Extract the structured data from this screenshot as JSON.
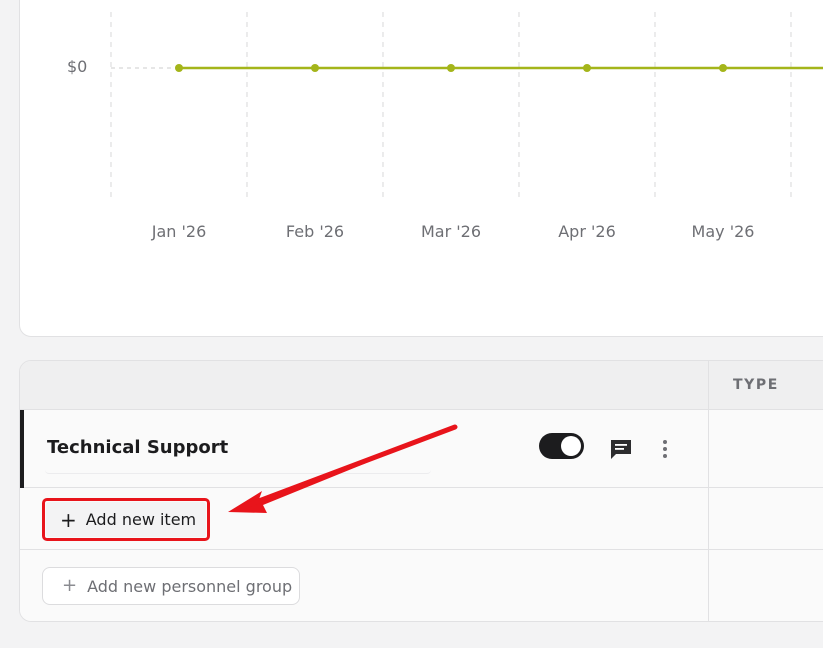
{
  "chart_data": {
    "type": "line",
    "x": [
      "Jan '26",
      "Feb '26",
      "Mar '26",
      "Apr '26",
      "May '26"
    ],
    "series": [
      {
        "values": [
          0,
          0,
          0,
          0,
          0
        ]
      }
    ],
    "yticks": [
      "$0"
    ],
    "grid": true,
    "color": "#a4b51a"
  },
  "table": {
    "columns": [
      "TYPE"
    ],
    "group": {
      "name": "Technical Support",
      "toggle_on": true,
      "icons": [
        "comment-icon",
        "more-vertical-icon"
      ]
    },
    "add_item_label": "Add new item",
    "add_group_label": "Add new personnel group"
  },
  "annotation": {
    "color": "#e8141b"
  }
}
